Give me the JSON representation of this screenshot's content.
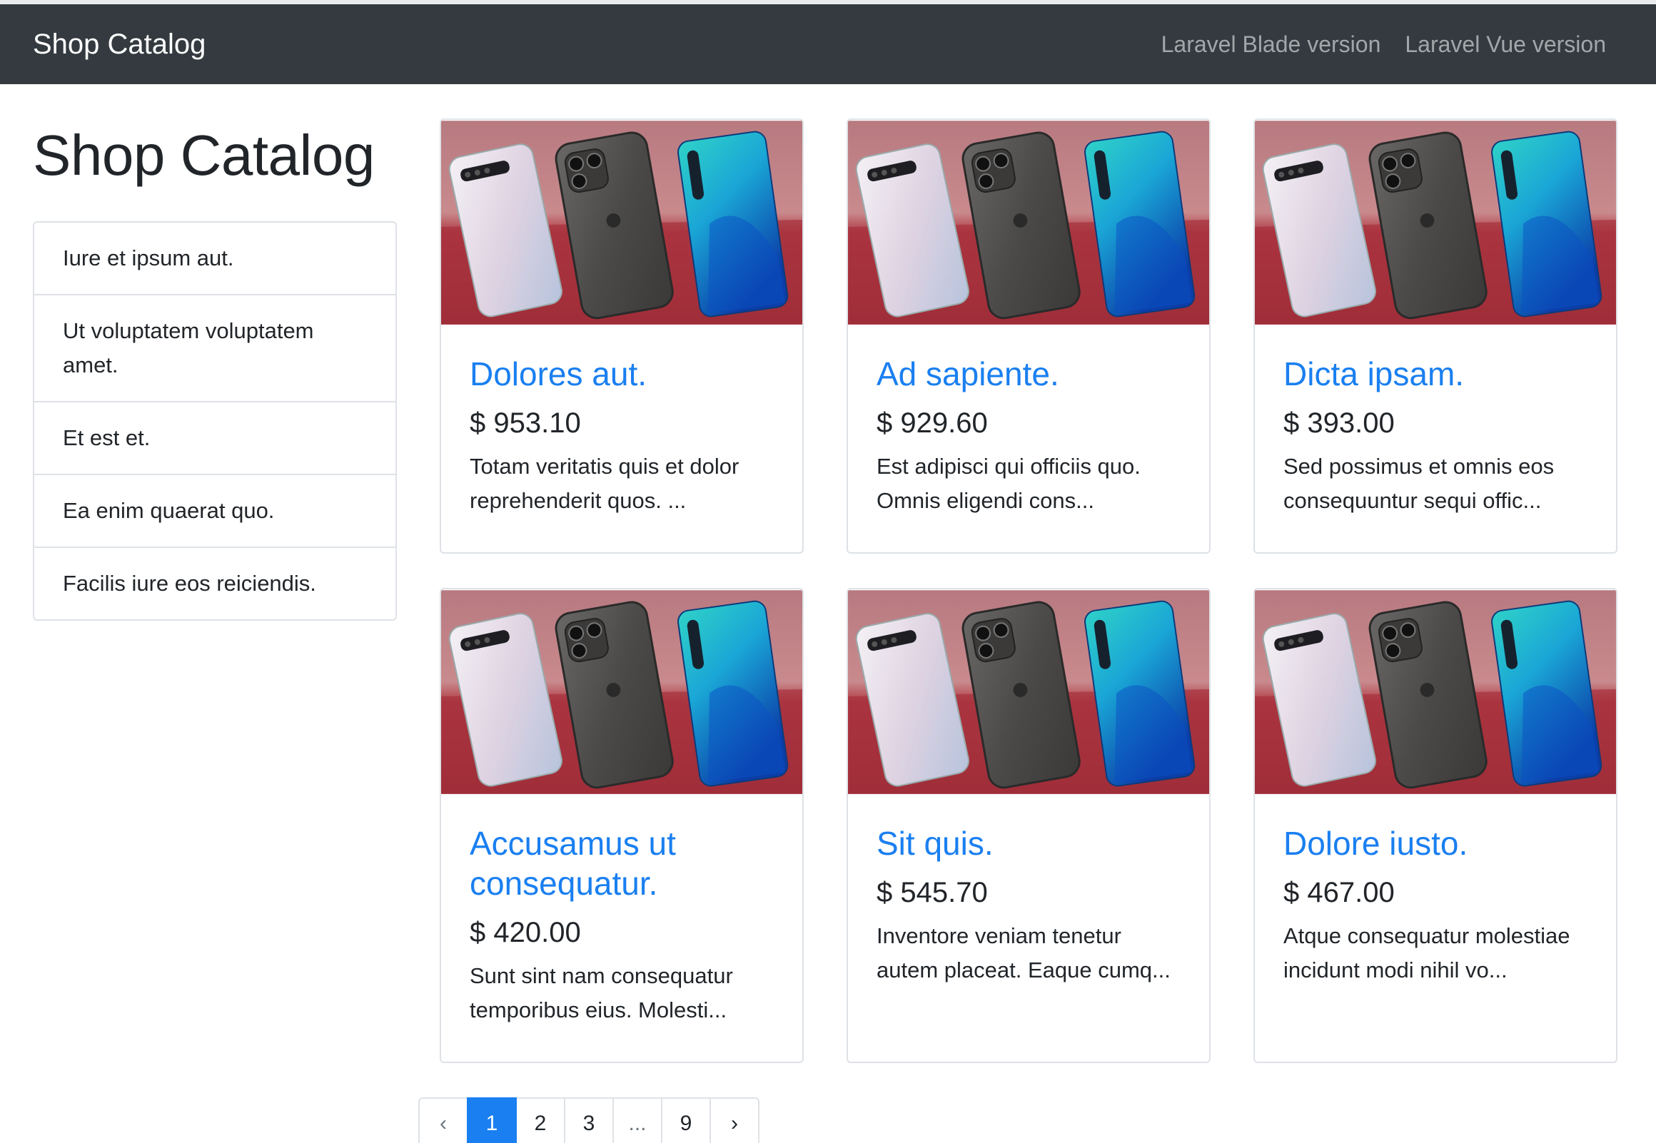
{
  "navbar": {
    "brand": "Shop Catalog",
    "links": [
      "Laravel Blade version",
      "Laravel Vue version"
    ]
  },
  "page_title": "Shop Catalog",
  "categories": [
    "Iure et ipsum aut.",
    "Ut voluptatem voluptatem amet.",
    "Et est et.",
    "Ea enim quaerat quo.",
    "Facilis iure eos reiciendis."
  ],
  "products": [
    {
      "title": "Dolores aut.",
      "price": "$ 953.10",
      "description": "Totam veritatis quis et dolor reprehenderit quos. ..."
    },
    {
      "title": "Ad sapiente.",
      "price": "$ 929.60",
      "description": "Est adipisci qui officiis quo. Omnis eligendi cons..."
    },
    {
      "title": "Dicta ipsam.",
      "price": "$ 393.00",
      "description": "Sed possimus et omnis eos consequuntur sequi offic..."
    },
    {
      "title": "Accusamus ut consequatur.",
      "price": "$ 420.00",
      "description": "Sunt sint nam consequatur temporibus eius. Molesti..."
    },
    {
      "title": "Sit quis.",
      "price": "$ 545.70",
      "description": "Inventore veniam tenetur autem placeat. Eaque cumq..."
    },
    {
      "title": "Dolore iusto.",
      "price": "$ 467.00",
      "description": "Atque consequatur molestiae incidunt modi nihil vo..."
    }
  ],
  "pagination": {
    "prev": "‹",
    "pages": [
      "1",
      "2",
      "3",
      "...",
      "9"
    ],
    "active": "1",
    "next": "›"
  },
  "colors": {
    "navbar": "#343a40",
    "link": "#1a7ff0",
    "active_page": "#1a7ff0",
    "border": "#dee2e6"
  }
}
